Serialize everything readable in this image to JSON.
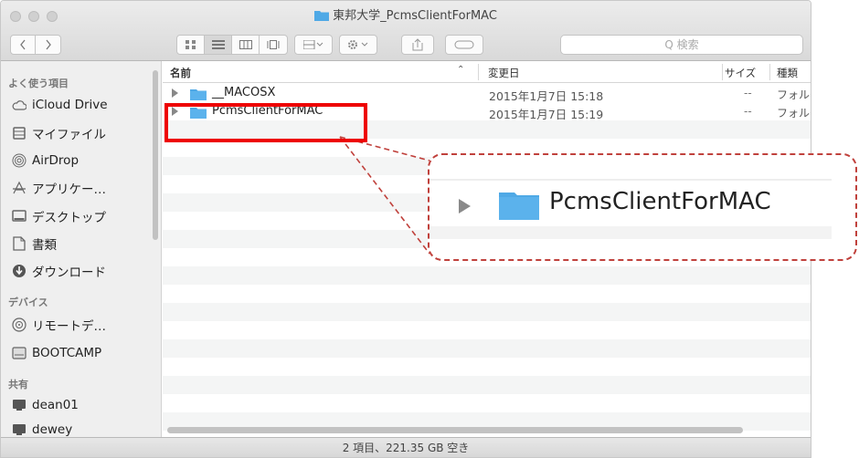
{
  "window": {
    "title": "東邦大学_PcmsClientForMAC",
    "search_placeholder": "Q 検索"
  },
  "sidebar": {
    "sections": [
      {
        "header": "よく使う項目",
        "items": [
          {
            "label": "iCloud Drive",
            "icon": "cloud-icon"
          },
          {
            "label": "マイファイル",
            "icon": "all-files-icon"
          },
          {
            "label": "AirDrop",
            "icon": "airdrop-icon"
          },
          {
            "label": "アプリケー…",
            "icon": "applications-icon"
          },
          {
            "label": "デスクトップ",
            "icon": "desktop-icon"
          },
          {
            "label": "書類",
            "icon": "documents-icon"
          },
          {
            "label": "ダウンロード",
            "icon": "downloads-icon"
          }
        ]
      },
      {
        "header": "デバイス",
        "items": [
          {
            "label": "リモートデ…",
            "icon": "remote-disc-icon"
          },
          {
            "label": "BOOTCAMP",
            "icon": "drive-icon"
          }
        ]
      },
      {
        "header": "共有",
        "items": [
          {
            "label": "dean01",
            "icon": "computer-icon"
          },
          {
            "label": "dewey",
            "icon": "computer-icon"
          }
        ]
      }
    ]
  },
  "list": {
    "columns": {
      "name": "名前",
      "modified": "変更日",
      "size": "サイズ",
      "kind": "種類"
    },
    "rows": [
      {
        "name": "__MACOSX",
        "modified": "2015年1月7日 15:18",
        "size": "--",
        "kind": "フォルダ"
      },
      {
        "name": "PcmsClientForMAC",
        "modified": "2015年1月7日 15:19",
        "size": "--",
        "kind": "フォルダ"
      }
    ]
  },
  "status": "2 項目、221.35 GB 空き",
  "callout": {
    "name": "PcmsClientForMAC"
  },
  "colors": {
    "folder_blue": "#4fa9e6",
    "highlight_red": "#ee0000",
    "callout_dash": "#c0413c"
  }
}
